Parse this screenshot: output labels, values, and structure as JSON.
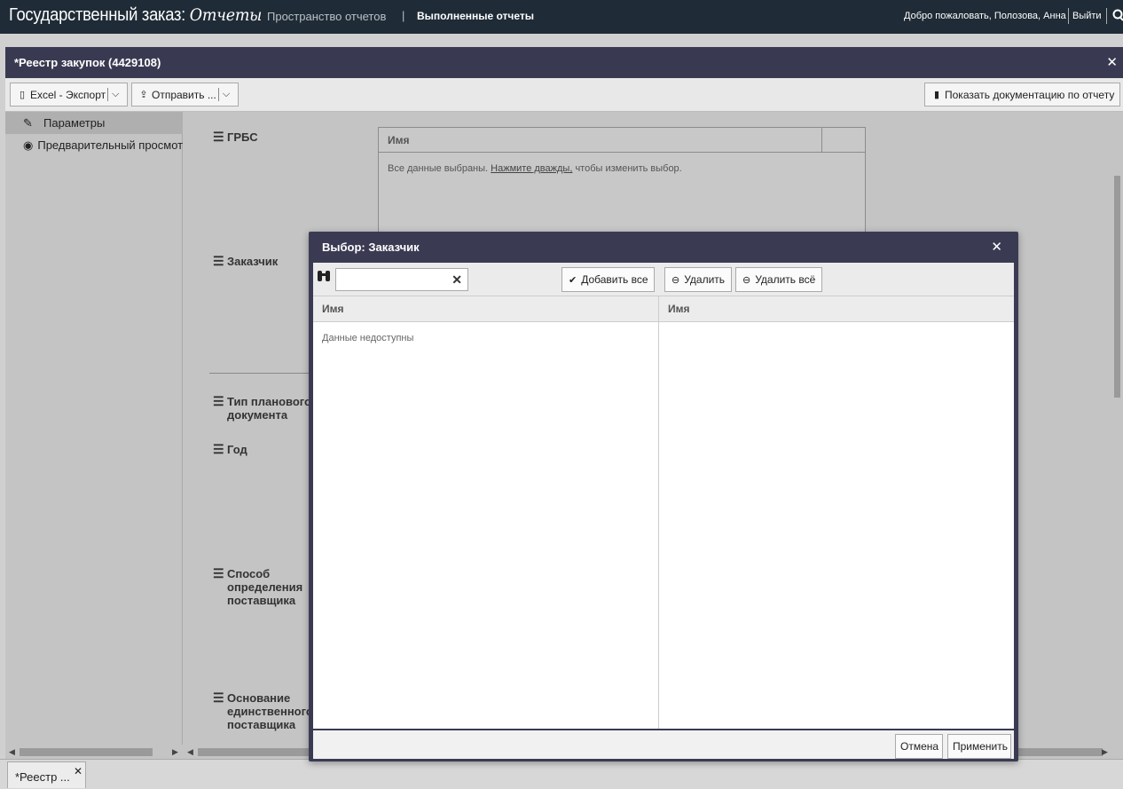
{
  "topbar": {
    "brand_main": "Государственный заказ:",
    "brand_sub": "Отчеты",
    "nav_reports_space": "Пространство отчетов",
    "nav_separator": "|",
    "nav_completed": "Выполненные отчеты",
    "welcome": "Добро пожаловать, Полозова, Анна",
    "logout": "Выйти"
  },
  "window": {
    "title": "*Реестр закупок (4429108)",
    "toolbar": {
      "excel_label": "Excel - Экспорт",
      "send_label": "Отправить ...",
      "docs_label": "Показать документацию по отчету"
    },
    "sidebar": {
      "items": [
        {
          "label": "Параметры",
          "icon": "edit-icon"
        },
        {
          "label": "Предварительный просмотр",
          "icon": "eye-icon"
        }
      ]
    },
    "params": [
      {
        "label": "ГРБС"
      },
      {
        "label": "Заказчик"
      },
      {
        "label": "Тип планового документа"
      },
      {
        "label": "Год финансирования"
      },
      {
        "label": "Способ определения поставщика"
      },
      {
        "label": "Основание единственного поставщика"
      }
    ],
    "grbs_table": {
      "header": "Имя",
      "note_prefix": "Все данные выбраны.",
      "note_link": "Нажмите дважды,",
      "note_suffix": "чтобы изменить выбор."
    }
  },
  "bottom_tabs": [
    {
      "label": "*Реестр ..."
    }
  ],
  "modal": {
    "title": "Выбор: Заказчик",
    "search": {
      "value": "",
      "placeholder": ""
    },
    "buttons": {
      "add_all": "Добавить все",
      "remove": "Удалить",
      "remove_all": "Удалить всё",
      "cancel": "Отмена",
      "apply": "Применить"
    },
    "available": {
      "header": "Имя",
      "empty_text": "Данные недоступны"
    },
    "selected": {
      "header": "Имя",
      "items": []
    }
  },
  "colors": {
    "topbar_bg": "#1f2b36",
    "window_title_bg": "#393a52",
    "modal_bg": "#3a3b53"
  }
}
